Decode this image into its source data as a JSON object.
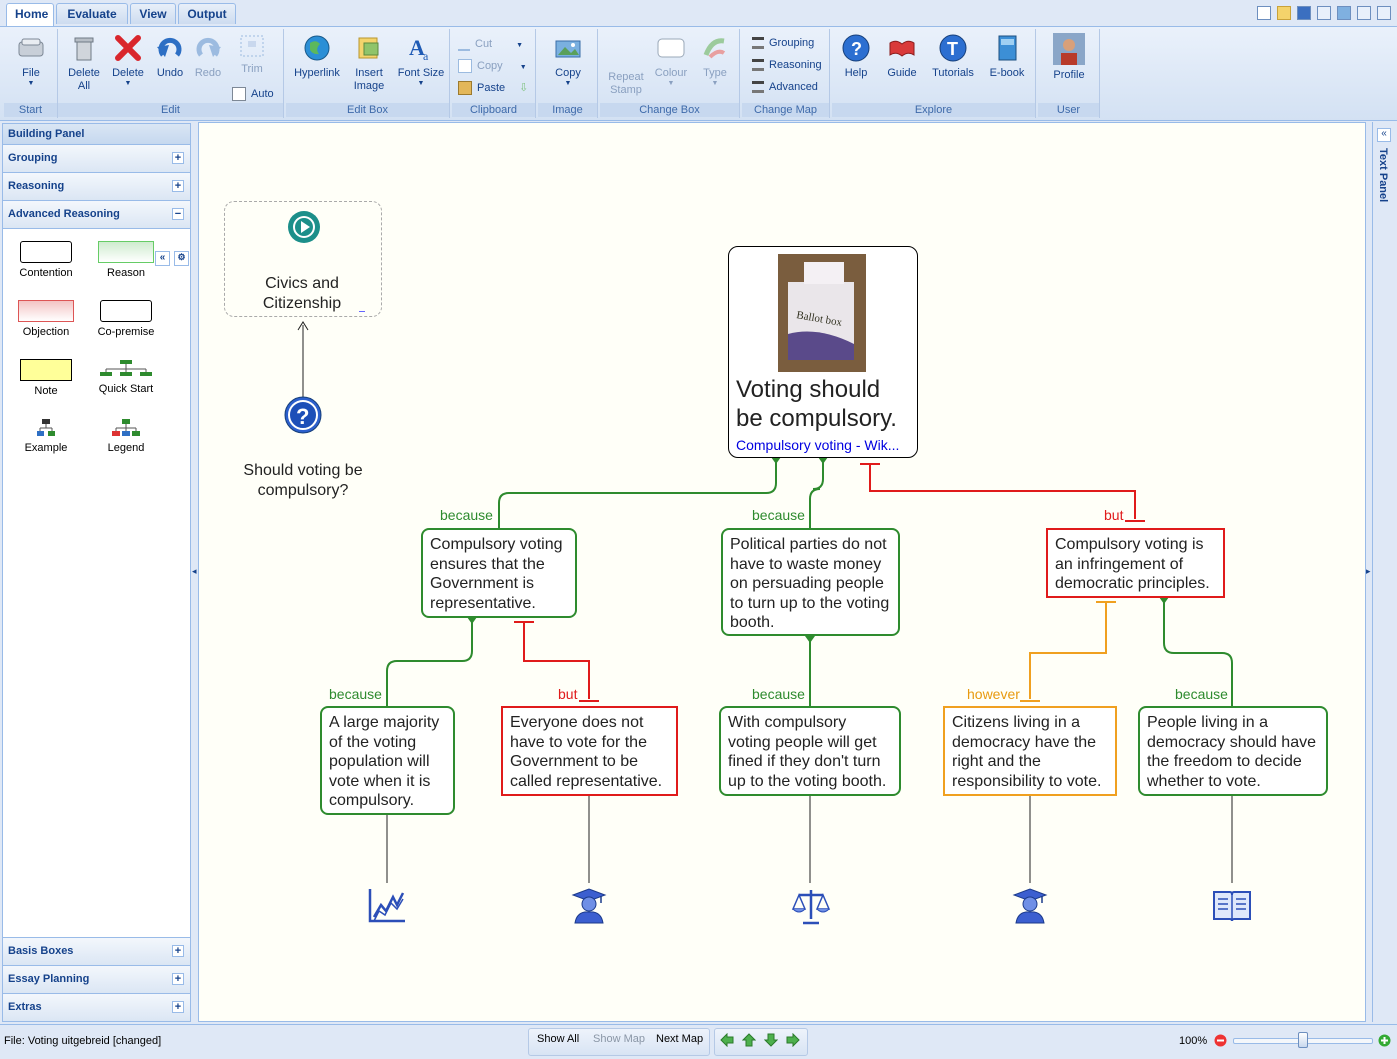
{
  "tabs": [
    "Home",
    "Evaluate",
    "View",
    "Output"
  ],
  "ribbon": {
    "start": {
      "title": "Start",
      "file": "File"
    },
    "edit": {
      "title": "Edit",
      "delete_all": "Delete All",
      "delete": "Delete",
      "undo": "Undo",
      "redo": "Redo",
      "trim": "Trim",
      "auto": "Auto"
    },
    "editbox": {
      "title": "Edit Box",
      "hyperlink": "Hyperlink",
      "insert_image": "Insert Image",
      "font_size": "Font Size"
    },
    "clipboard": {
      "title": "Clipboard",
      "cut": "Cut",
      "copy": "Copy",
      "paste": "Paste"
    },
    "image": {
      "title": "Image",
      "copy": "Copy"
    },
    "changebox": {
      "title": "Change Box",
      "repeat_stamp": "Repeat Stamp",
      "colour": "Colour",
      "type": "Type"
    },
    "changemap": {
      "title": "Change Map",
      "grouping": "Grouping",
      "reasoning": "Reasoning",
      "advanced": "Advanced"
    },
    "explore": {
      "title": "Explore",
      "help": "Help",
      "guide": "Guide",
      "tutorials": "Tutorials",
      "ebook": "E-book"
    },
    "user": {
      "title": "User",
      "profile": "Profile"
    }
  },
  "panel": {
    "title": "Building Panel",
    "sections_top": [
      "Grouping",
      "Reasoning",
      "Advanced Reasoning"
    ],
    "tools": [
      "Contention",
      "Reason",
      "Objection",
      "Co-premise",
      "Note",
      "Quick Start",
      "Example",
      "Legend"
    ],
    "sections_bottom": [
      "Basis Boxes",
      "Essay Planning",
      "Extras"
    ]
  },
  "text_panel": "Text Panel",
  "map": {
    "topic": "Civics and Citizenship",
    "question": "Should voting be compulsory?",
    "contention": "Voting should be compulsory.",
    "contention_link": "Compulsory voting - Wik...",
    "image_text": "Ballot box",
    "r1": "Compulsory voting ensures that the Government is representative.",
    "r2": "Political parties do not have to waste money on persuading people to turn up to the voting booth.",
    "o1": "Compulsory voting is an infringement of democratic principles.",
    "r1a": "A large majority of the voting population will vote when it is compulsory.",
    "o1a": "Everyone does not have to vote for the Government to be called representative.",
    "r2a": "With compulsory voting people will get fined if they don't turn up to the voting booth.",
    "h1": "Citizens living in a democracy have the right and the responsibility to vote.",
    "r3": "People living in a democracy should have the freedom to decide whether to vote.",
    "because": "because",
    "but": "but",
    "however": "however"
  },
  "status": {
    "file": "File: Voting uitgebreid [changed]",
    "show_all": "Show All",
    "show_map": "Show Map",
    "next_map": "Next Map",
    "zoom": "100%"
  }
}
